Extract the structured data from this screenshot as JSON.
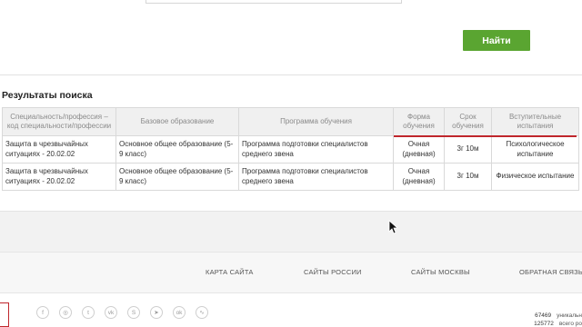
{
  "search": {
    "button_label": "Найти"
  },
  "results": {
    "title": "Результаты поиска",
    "columns": [
      "Специальность/профессия – код специальности/профессии",
      "Базовое образование",
      "Программа обучения",
      "Форма обучения",
      "Срок обучения",
      "Вступительные испытания"
    ],
    "rows": [
      [
        "Защита в чрезвычайных ситуациях - 20.02.02",
        "Основное общее образование (5-9 класс)",
        "Программа подготовки специалистов среднего звена",
        "Очная (дневная)",
        "3г 10м",
        "Психологическое испытание"
      ],
      [
        "Защита в чрезвычайных ситуациях - 20.02.02",
        "Основное общее образование (5-9 класс)",
        "Программа подготовки специалистов среднего звена",
        "Очная (дневная)",
        "3г 10м",
        "Физическое испытание"
      ]
    ]
  },
  "footer": {
    "links": [
      "КАРТА САЙТА",
      "САЙТЫ РОССИИ",
      "САЙТЫ МОСКВЫ",
      "ОБРАТНАЯ СВЯЗЬ"
    ],
    "social_icons": [
      "facebook-icon",
      "instagram-icon",
      "twitter-icon",
      "vk-icon",
      "skype-icon",
      "telegram-icon",
      "odnoklassniki-icon",
      "rss-icon"
    ],
    "social_glyphs": [
      "f",
      "◎",
      "t",
      "vk",
      "S",
      "➤",
      "ok",
      "∿"
    ],
    "counters": [
      {
        "value": "67469",
        "label": "уникальн"
      },
      {
        "value": "125772",
        "label": "всего ро"
      }
    ]
  },
  "colors": {
    "accent_green": "#5aa531",
    "accent_red": "#c0262c"
  }
}
